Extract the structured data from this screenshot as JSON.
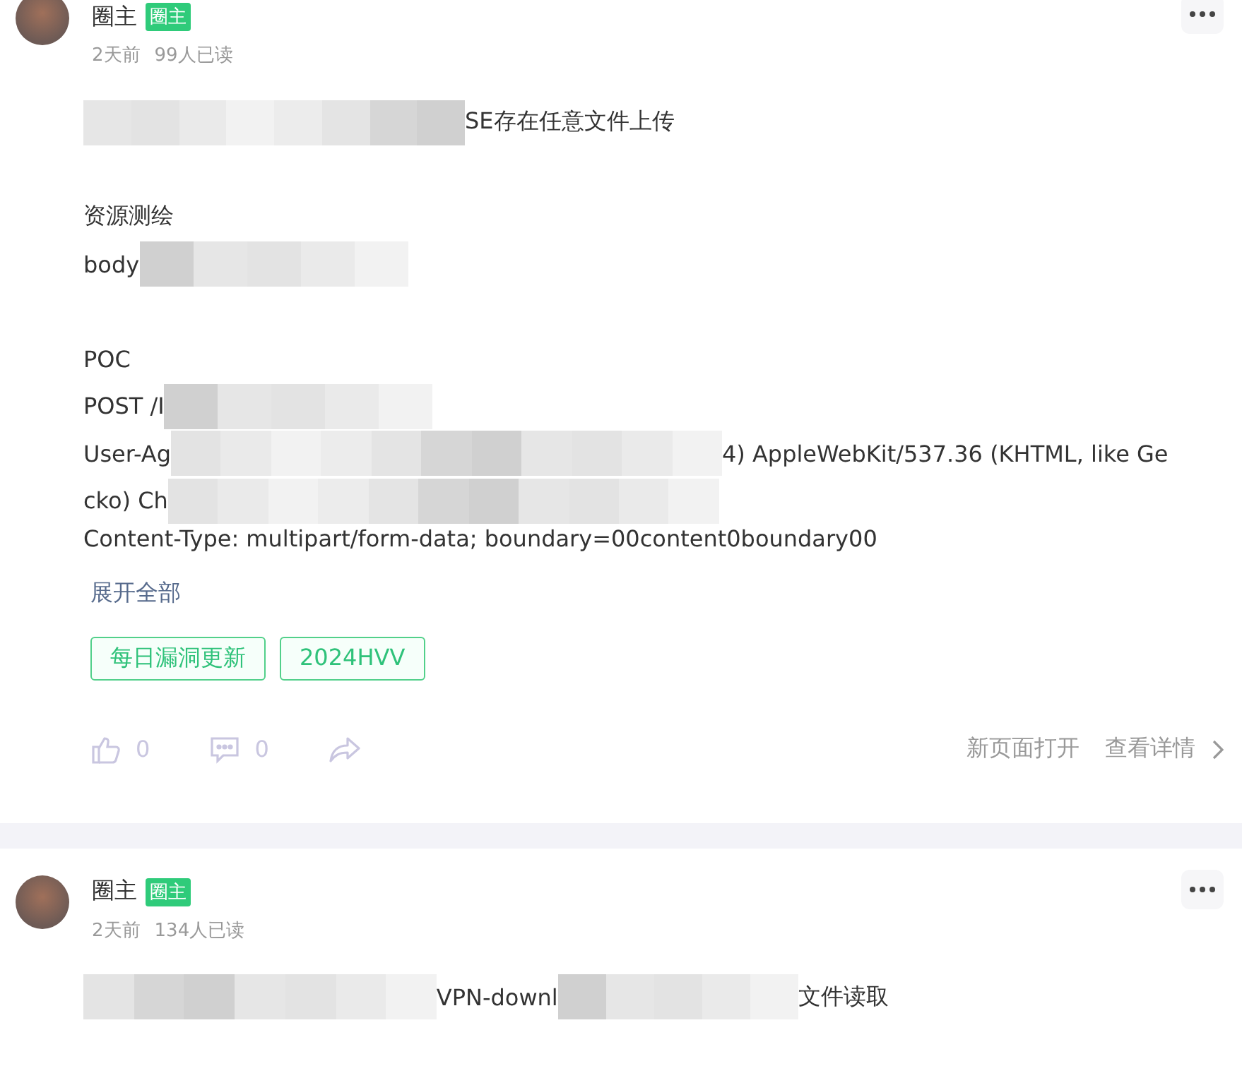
{
  "posts": [
    {
      "author": "圈主",
      "badge": "圈主",
      "time": "2天前",
      "reads": "99人已读",
      "lines": [
        {
          "kind": "content",
          "segments": [
            {
              "kind": "mosaic"
            },
            {
              "kind": "text",
              "text": "SE存在任意文件上传"
            }
          ]
        },
        {
          "kind": "blank"
        },
        {
          "kind": "content",
          "segments": [
            {
              "kind": "text",
              "text": "资源测绘"
            }
          ]
        },
        {
          "kind": "content",
          "segments": [
            {
              "kind": "text",
              "text": "body"
            },
            {
              "kind": "mosaic"
            }
          ]
        },
        {
          "kind": "blank"
        },
        {
          "kind": "content",
          "segments": [
            {
              "kind": "text",
              "text": "POC"
            }
          ]
        },
        {
          "kind": "content",
          "segments": [
            {
              "kind": "text",
              "text": "POST /I"
            },
            {
              "kind": "mosaic"
            }
          ]
        },
        {
          "kind": "content",
          "segments": [
            {
              "kind": "text",
              "text": "User-Ag"
            },
            {
              "kind": "mosaic"
            },
            {
              "kind": "text",
              "text": "4) AppleWebKit/537.36 (KHTML, like Ge"
            }
          ]
        },
        {
          "kind": "content",
          "segments": [
            {
              "kind": "text",
              "text": "cko) Ch"
            },
            {
              "kind": "mosaic"
            }
          ]
        },
        {
          "kind": "content",
          "segments": [
            {
              "kind": "text",
              "text": "Content-Type: multipart/form-data; boundary=00content0boundary00"
            }
          ]
        }
      ],
      "truncated": true,
      "expand": "展开全部",
      "tags": [
        "每日漏洞更新",
        "2024HVV"
      ],
      "likes": "0",
      "comments": "0",
      "open_new": "新页面打开",
      "details": "查看详情"
    },
    {
      "author": "圈主",
      "badge": "圈主",
      "time": "2天前",
      "reads": "134人已读",
      "lines": [
        {
          "kind": "content",
          "segments": [
            {
              "kind": "mosaic"
            },
            {
              "kind": "text",
              "text": "VPN-downl"
            },
            {
              "kind": "mosaic"
            },
            {
              "kind": "text",
              "text": "文件读取"
            }
          ]
        }
      ]
    }
  ]
}
